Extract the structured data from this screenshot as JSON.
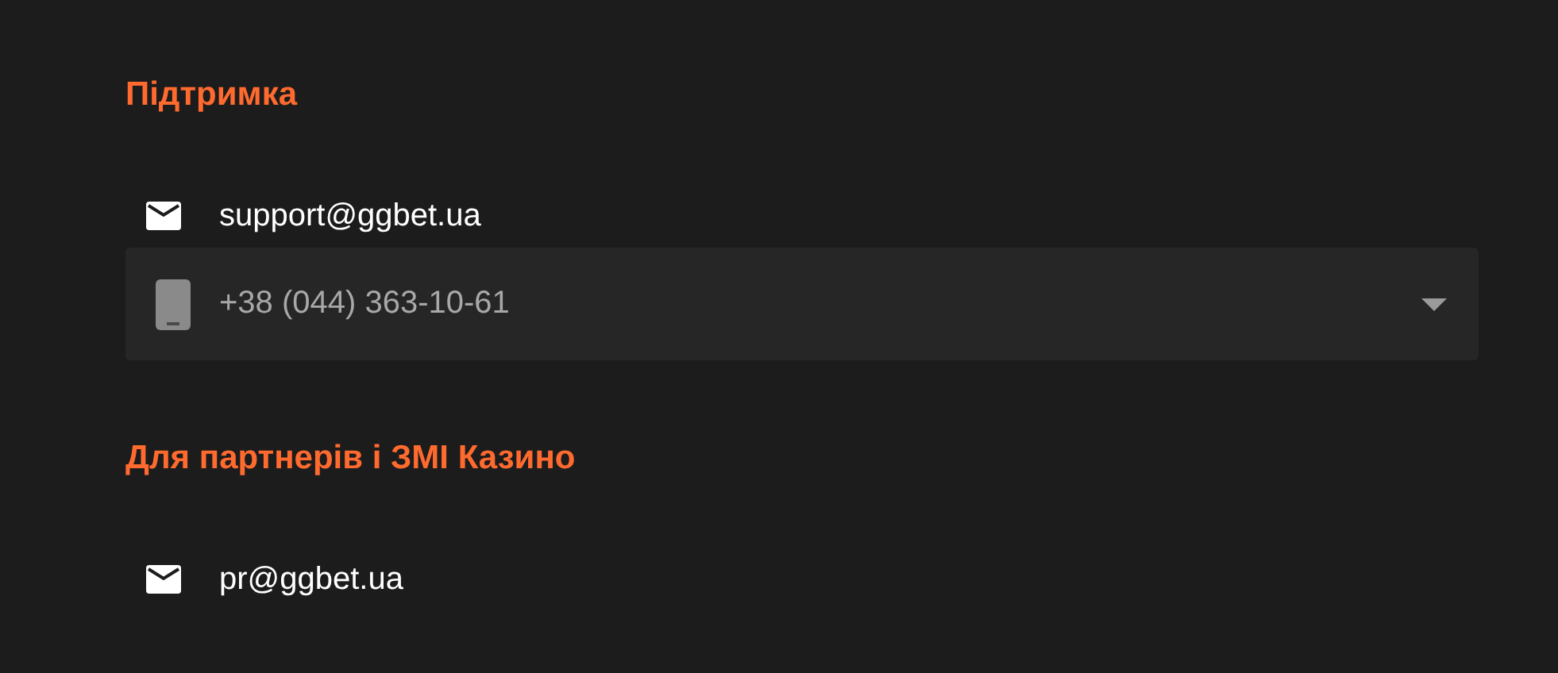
{
  "sections": [
    {
      "title": "Підтримка",
      "contacts": [
        {
          "kind": "email",
          "text": "support@ggbet.ua"
        },
        {
          "kind": "phone",
          "text": "+38 (044) 363-10-61",
          "expanded": false
        }
      ]
    },
    {
      "title": "Для партнерів і ЗМІ Казино",
      "contacts": [
        {
          "kind": "email",
          "text": "pr@ggbet.ua"
        }
      ]
    }
  ]
}
